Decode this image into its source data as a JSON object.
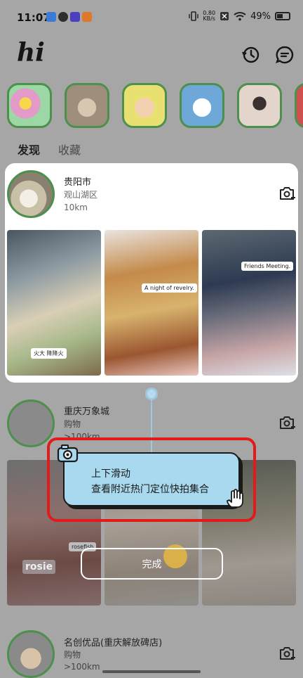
{
  "status_bar": {
    "time": "11:07",
    "network_speed_value": "0.80",
    "network_speed_unit": "KB/s",
    "battery": "49%"
  },
  "header": {
    "logo": "hi",
    "history_icon": "history-clock-icon",
    "message_icon": "chat-bubble-icon"
  },
  "tabs": [
    {
      "label": "发现",
      "active": true
    },
    {
      "label": "收藏",
      "active": false
    }
  ],
  "locations": [
    {
      "title": "贵阳市",
      "subtitle": "观山湖区",
      "distance": "10km",
      "photo_captions": [
        "火大 降降火",
        "A night of revelry.",
        "Friends Meeting."
      ]
    },
    {
      "title": "重庆万象城",
      "subtitle": "购物",
      "distance": ">100km",
      "photo_captions": [
        "rosefish",
        "rosie"
      ]
    },
    {
      "title": "名创优品(重庆解放碑店)",
      "subtitle": "购物",
      "distance": ">100km"
    }
  ],
  "tooltip": {
    "line1": "上下滑动",
    "line2": "查看附近热门定位快拍集合"
  },
  "done_button": "完成",
  "colors": {
    "overlay_dim": "#a6a6a6",
    "avatar_ring": "#4d8f4d",
    "tooltip_bg": "#a8d9ee",
    "highlight_frame": "#e31a1a"
  }
}
